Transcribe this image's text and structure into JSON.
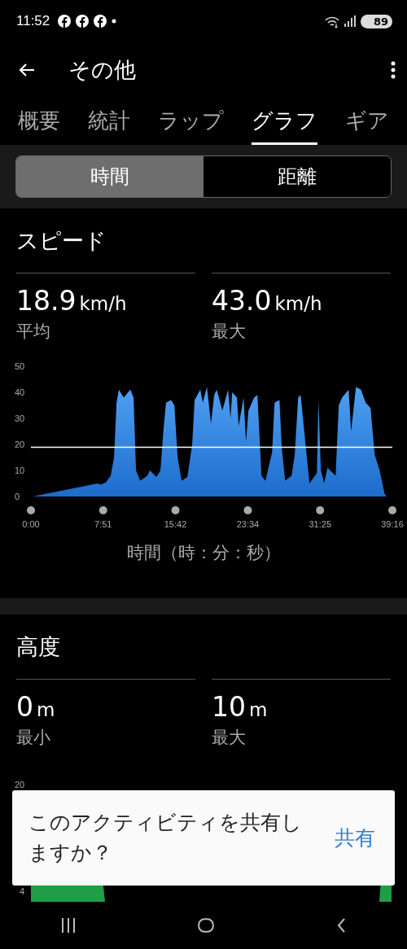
{
  "status_bar": {
    "time": "11:52",
    "notifications": [
      {
        "kind": "facebook"
      },
      {
        "kind": "facebook"
      },
      {
        "kind": "facebook"
      },
      {
        "kind": "dot"
      }
    ],
    "battery": "89"
  },
  "app_bar": {
    "title": "その他"
  },
  "tabs": [
    {
      "label": "概要",
      "selected": false
    },
    {
      "label": "統計",
      "selected": false
    },
    {
      "label": "ラップ",
      "selected": false
    },
    {
      "label": "グラフ",
      "selected": true
    },
    {
      "label": "ギア",
      "selected": false
    }
  ],
  "segments": [
    {
      "label": "時間",
      "selected": true
    },
    {
      "label": "距離",
      "selected": false
    }
  ],
  "sections": [
    {
      "title": "スピード",
      "stats": [
        {
          "value": "18.9",
          "unit": "km/h",
          "label": "平均"
        },
        {
          "value": "43.0",
          "unit": "km/h",
          "label": "最大"
        }
      ],
      "chart_data": {
        "type": "area",
        "x": [
          11,
          435,
          457,
          489,
          520,
          542,
          558,
          573,
          605,
          648,
          669,
          685,
          712,
          759,
          775,
          818,
          844,
          866,
          881,
          913,
          935,
          956,
          982,
          1020,
          1051,
          1067,
          1104,
          1120,
          1147,
          1174,
          1195,
          1211,
          1248,
          1285,
          1301,
          1312,
          1343,
          1354,
          1386,
          1402,
          1418,
          1455,
          1476,
          1503,
          1529,
          1572,
          1588,
          1620,
          1635,
          1657,
          1699,
          1720,
          1742,
          1758,
          1795,
          1816,
          1864,
          1874,
          1890,
          1912,
          1933,
          1986,
          2007,
          2028,
          2071,
          2087,
          2119,
          2151,
          2182,
          2214,
          2241,
          2273,
          2305,
          2320
        ],
        "values": [
          0,
          5,
          4.5,
          5.5,
          8,
          15,
          36,
          41,
          38,
          41,
          38,
          10,
          6,
          8,
          10,
          7.5,
          10,
          27,
          36,
          37,
          35,
          15,
          6,
          7.5,
          20,
          37,
          41,
          36,
          42,
          28,
          39,
          41,
          33,
          41,
          30,
          40,
          38,
          27,
          38,
          21,
          33,
          38,
          39,
          8,
          6,
          17,
          36,
          37,
          19,
          6,
          8,
          16,
          38,
          39,
          17,
          5,
          9,
          37,
          10,
          5,
          11,
          8,
          35,
          38,
          41,
          25,
          42,
          41,
          36,
          34,
          16,
          10,
          1,
          0
        ],
        "xlim": [
          0,
          2356
        ],
        "ylim": [
          0,
          50
        ],
        "yticks": [
          0,
          10,
          20,
          30,
          40,
          50
        ],
        "xticks": [
          {
            "value": 0,
            "label": "0:00"
          },
          {
            "value": 471,
            "label": "7:51"
          },
          {
            "value": 942,
            "label": "15:42"
          },
          {
            "value": 1414,
            "label": "23:34"
          },
          {
            "value": 1885,
            "label": "31:25"
          },
          {
            "value": 2356,
            "label": "39:16"
          }
        ],
        "ref_lines": [
          {
            "axis": "y",
            "value": 18.9
          }
        ]
      },
      "axis_title": "時間（時：分：秒）"
    },
    {
      "title": "高度",
      "stats": [
        {
          "value": "0",
          "unit": "m",
          "label": "最小"
        },
        {
          "value": "10",
          "unit": "m",
          "label": "最大"
        }
      ],
      "chart_tick_labels": [
        "20",
        "4"
      ]
    }
  ],
  "snackbar": {
    "message": "このアクティビティを共有しますか？",
    "action": "共有"
  }
}
